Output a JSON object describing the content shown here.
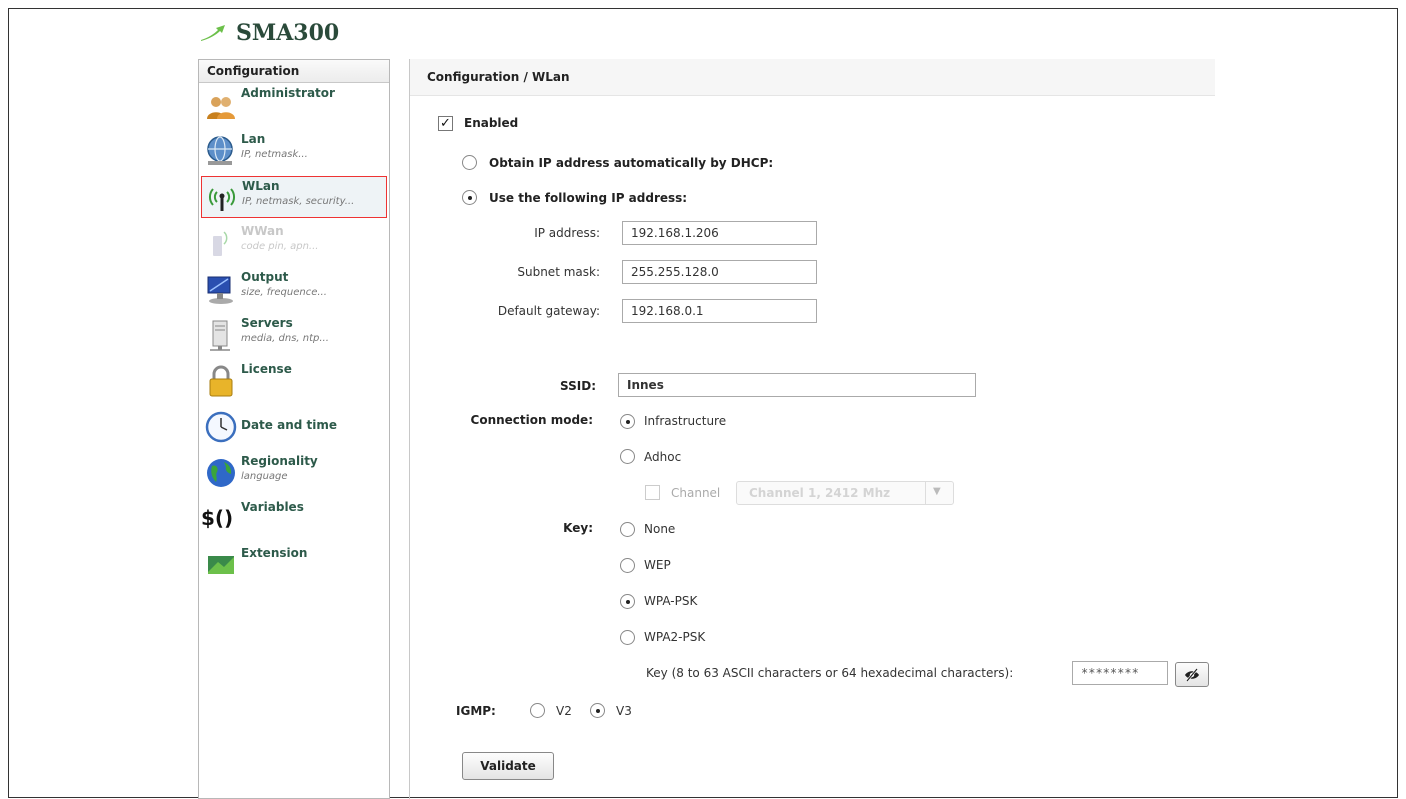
{
  "app": {
    "title": "SMA300"
  },
  "sidebar": {
    "header": "Configuration",
    "items": [
      {
        "title": "Administrator",
        "subtitle": ""
      },
      {
        "title": "Lan",
        "subtitle": "IP, netmask..."
      },
      {
        "title": "WLan",
        "subtitle": "IP, netmask, security..."
      },
      {
        "title": "WWan",
        "subtitle": "code pin, apn..."
      },
      {
        "title": "Output",
        "subtitle": "size, frequence..."
      },
      {
        "title": "Servers",
        "subtitle": "media, dns, ntp..."
      },
      {
        "title": "License",
        "subtitle": ""
      },
      {
        "title": "Date and time",
        "subtitle": ""
      },
      {
        "title": "Regionality",
        "subtitle": "language"
      },
      {
        "title": "Variables",
        "subtitle": "",
        "icon_text": "$()"
      },
      {
        "title": "Extension",
        "subtitle": ""
      }
    ]
  },
  "main": {
    "breadcrumb": "Configuration / WLan",
    "enabled_label": "Enabled",
    "enabled_mark": "✓",
    "dhcp_label": "Obtain IP address automatically by DHCP:",
    "static_label": "Use the following IP address:",
    "ip_label": "IP address:",
    "ip_value": "192.168.1.206",
    "mask_label": "Subnet mask:",
    "mask_value": "255.255.128.0",
    "gateway_label": "Default gateway:",
    "gateway_value": "192.168.0.1",
    "ssid_label": "SSID:",
    "ssid_value": "Innes",
    "conn_label": "Connection mode:",
    "conn_infra": "Infrastructure",
    "conn_adhoc": "Adhoc",
    "channel_label": "Channel",
    "channel_value": "Channel 1, 2412 Mhz",
    "key_label": "Key:",
    "key_none": "None",
    "key_wep": "WEP",
    "key_wpa": "WPA-PSK",
    "key_wpa2": "WPA2-PSK",
    "key_hint": "Key (8 to 63 ASCII characters or 64 hexadecimal characters):",
    "key_value": "********",
    "igmp_label": "IGMP:",
    "igmp_v2": "V2",
    "igmp_v3": "V3",
    "validate_label": "Validate"
  },
  "colors": {
    "selected_border": "#e33333",
    "title_green": "#2d5a4a"
  }
}
